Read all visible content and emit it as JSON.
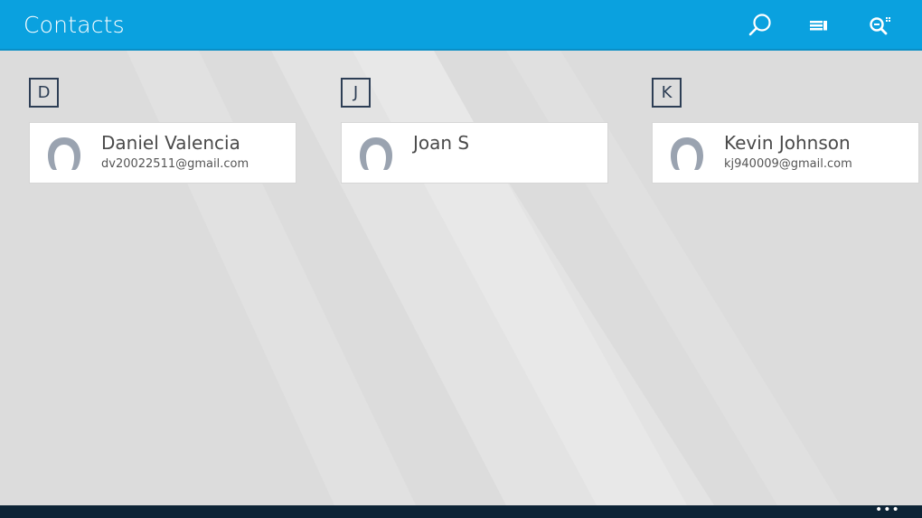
{
  "app": {
    "title": "Contacts",
    "accent_color": "#0aa1df",
    "background_color": "#dcdcdc",
    "bottom_bar_color": "#0d2436"
  },
  "header": {
    "actions": [
      {
        "icon": "search-icon"
      },
      {
        "icon": "select-list-icon"
      },
      {
        "icon": "zoom-filter-icon"
      }
    ]
  },
  "groups": [
    {
      "letter": "D",
      "contact": {
        "name": "Daniel Valencia",
        "email": "dv20022511@gmail.com",
        "avatar_icon": "person-avatar-icon"
      }
    },
    {
      "letter": "J",
      "contact": {
        "name": "Joan S",
        "email": "",
        "avatar_icon": "person-avatar-icon"
      }
    },
    {
      "letter": "K",
      "contact": {
        "name": "Kevin Johnson",
        "email": "kj940009@gmail.com",
        "avatar_icon": "person-avatar-icon"
      }
    }
  ],
  "app_bar": {
    "more_label": "•••"
  }
}
